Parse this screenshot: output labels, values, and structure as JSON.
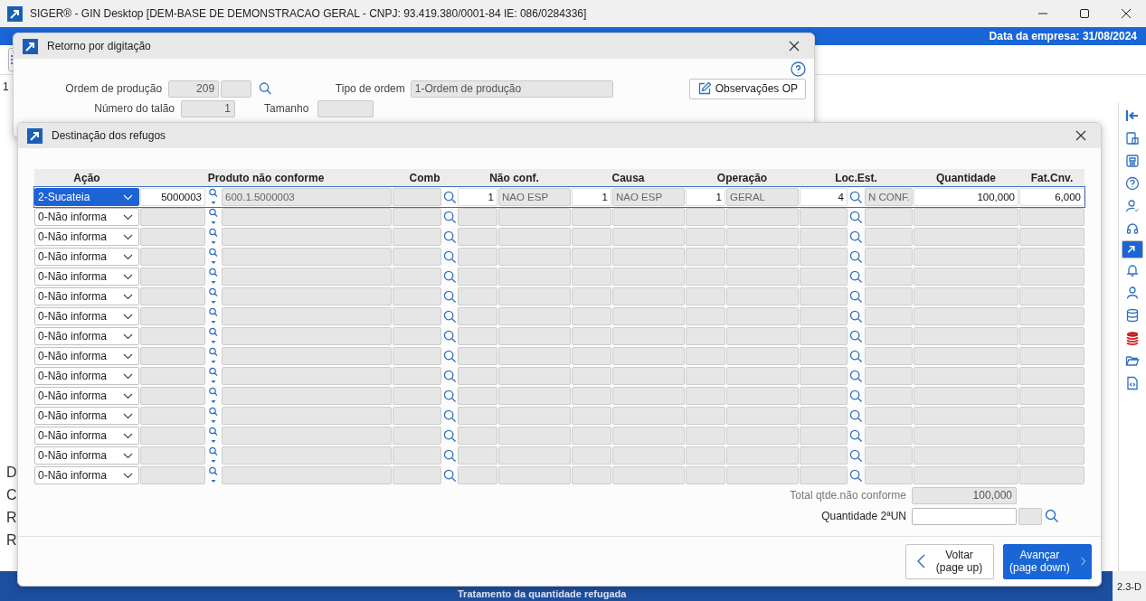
{
  "window": {
    "title": "SIGER® - GIN Desktop [DEM-BASE DE DEMONSTRACAO GERAL - CNPJ: 93.419.380/0001-84 IE: 086/0284336]"
  },
  "header_bar": {
    "company_date": "Data da empresa: 31/08/2024"
  },
  "background": {
    "toolbar_fragment": "1",
    "side_letters": [
      "D",
      "C",
      "R",
      "R"
    ]
  },
  "side_toolbar": [
    {
      "kind": "collapse",
      "selected": false
    },
    {
      "kind": "tree",
      "selected": false
    },
    {
      "kind": "news",
      "selected": false
    },
    {
      "kind": "help",
      "selected": false
    },
    {
      "kind": "user-check",
      "selected": false
    },
    {
      "kind": "headset",
      "selected": false
    },
    {
      "kind": "launcher",
      "selected": true
    },
    {
      "kind": "bell",
      "selected": false
    },
    {
      "kind": "user",
      "selected": false
    },
    {
      "kind": "database",
      "selected": false
    },
    {
      "kind": "coins",
      "selected": false
    },
    {
      "kind": "folder",
      "selected": false
    },
    {
      "kind": "code",
      "selected": false
    }
  ],
  "return_dialog": {
    "title": "Retorno por digitação",
    "order_label": "Ordem de produção",
    "order_value": "209",
    "type_label": "Tipo de ordem",
    "type_value": "1-Ordem de produção",
    "ticket_label": "Número do talão",
    "ticket_value": "1",
    "size_label": "Tamanho",
    "notes_button": "Observações OP"
  },
  "scrap_dialog": {
    "title": "Destinação dos refugos",
    "columns": [
      "Ação",
      "Produto não conforme",
      "Comb",
      "Não conf.",
      "Causa",
      "Operação",
      "Loc.Est.",
      "Quantidade",
      "Fat.Cnv."
    ],
    "rows": [
      {
        "selected": true,
        "action": "2-Sucateia",
        "product_code": "5000003",
        "product": "600.1.5000003",
        "nonconf_code": "1",
        "nonconf": "NAO ESP",
        "cause_code": "1",
        "cause": "NAO ESP",
        "operation_code": "1",
        "operation": "GERAL",
        "location_code": "4",
        "location": "N CONF.",
        "quantity": "100,000",
        "factor": "6,000"
      },
      {
        "selected": false,
        "action": "0-Não informa"
      },
      {
        "selected": false,
        "action": "0-Não informa"
      },
      {
        "selected": false,
        "action": "0-Não informa"
      },
      {
        "selected": false,
        "action": "0-Não informa"
      },
      {
        "selected": false,
        "action": "0-Não informa"
      },
      {
        "selected": false,
        "action": "0-Não informa"
      },
      {
        "selected": false,
        "action": "0-Não informa"
      },
      {
        "selected": false,
        "action": "0-Não informa"
      },
      {
        "selected": false,
        "action": "0-Não informa"
      },
      {
        "selected": false,
        "action": "0-Não informa"
      },
      {
        "selected": false,
        "action": "0-Não informa"
      },
      {
        "selected": false,
        "action": "0-Não informa"
      },
      {
        "selected": false,
        "action": "0-Não informa"
      },
      {
        "selected": false,
        "action": "0-Não informa"
      }
    ],
    "total_label": "Total qtde.não conforme",
    "total_value": "100,000",
    "qty2_label": "Quantidade 2ªUN",
    "back_button": {
      "label": "Voltar",
      "hint": "(page up)"
    },
    "next_button": {
      "label": "Avançar",
      "hint": "(page down)"
    }
  },
  "status_bar": {
    "message": "Tratamento da quantidade refugada",
    "version": "2.3-D"
  }
}
